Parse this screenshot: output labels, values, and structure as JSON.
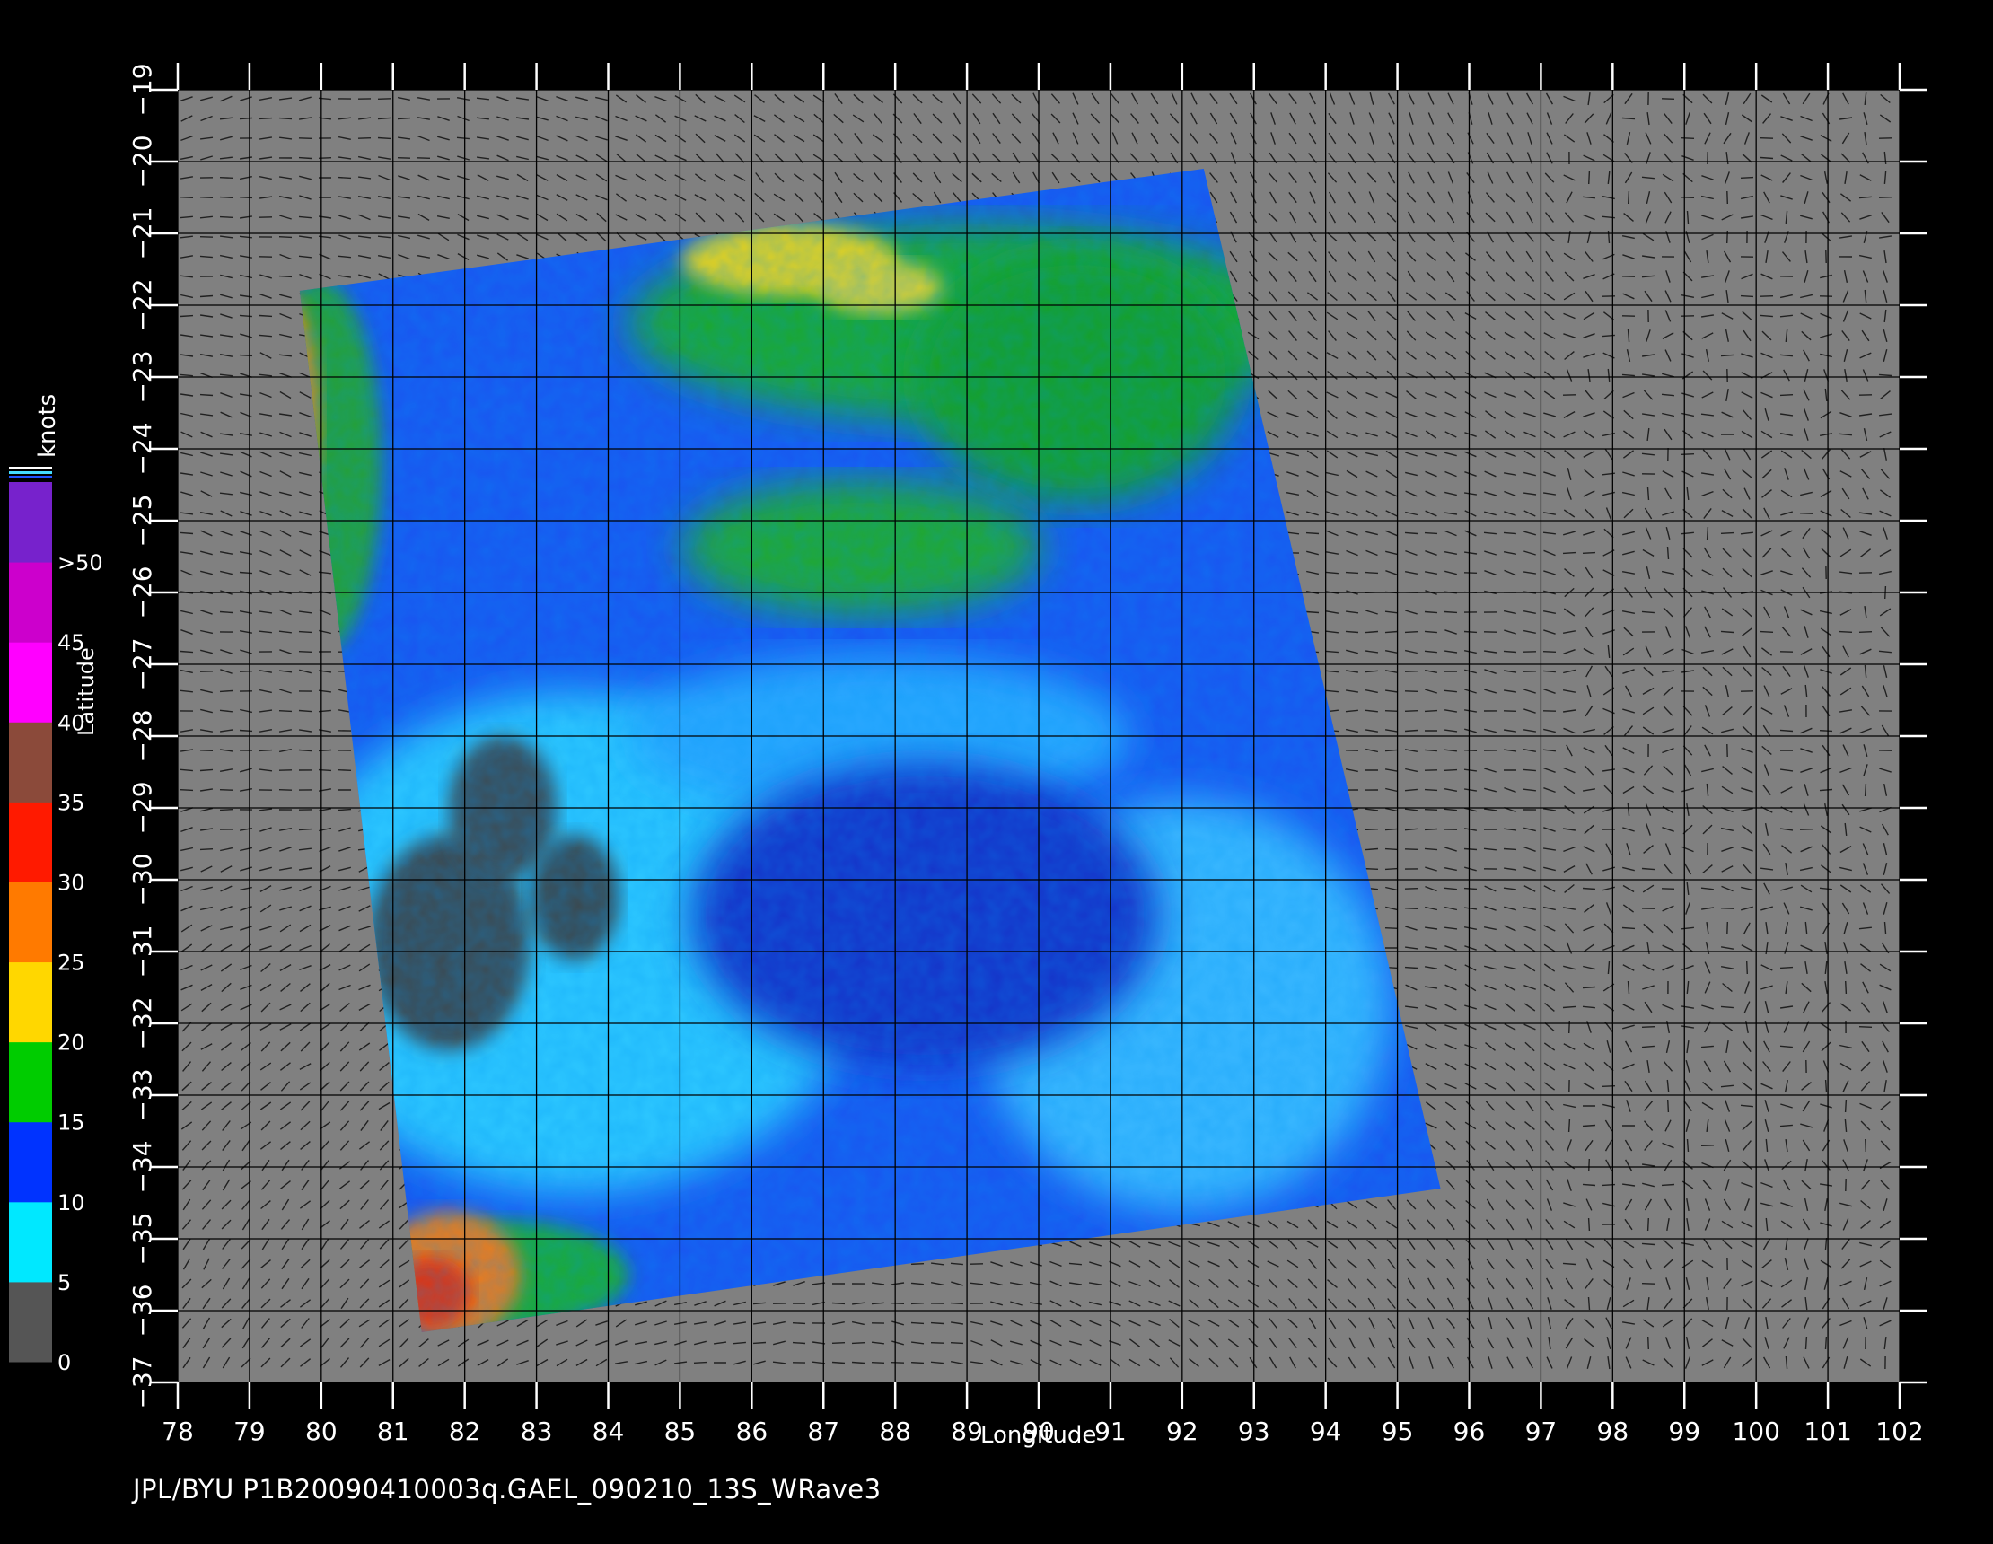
{
  "footer": {
    "text": "JPL/BYU  P1B20090410003q.GAEL_090210_13S_WRave3"
  },
  "chart_data": {
    "type": "heatmap",
    "title": "",
    "xlabel": "Longitude",
    "ylabel": "Latitude",
    "xlim": [
      78,
      102
    ],
    "ylim": [
      -37,
      -19
    ],
    "x_ticks": [
      78,
      79,
      80,
      81,
      82,
      83,
      84,
      85,
      86,
      87,
      88,
      89,
      90,
      91,
      92,
      93,
      94,
      95,
      96,
      97,
      98,
      99,
      100,
      101,
      102
    ],
    "y_ticks": [
      -19,
      -20,
      -21,
      -22,
      -23,
      -24,
      -25,
      -26,
      -27,
      -28,
      -29,
      -30,
      -31,
      -32,
      -33,
      -34,
      -35,
      -36,
      -37
    ],
    "grid": true,
    "swath_corners_lonlat": [
      [
        79.7,
        -21.8
      ],
      [
        92.3,
        -20.1
      ],
      [
        95.6,
        -34.3
      ],
      [
        81.4,
        -36.3
      ]
    ],
    "colorbar": {
      "title": "knots",
      "tick_labels": [
        ">50",
        "45",
        "40",
        "35",
        "30",
        "25",
        "20",
        "15",
        "10",
        "5",
        "0"
      ],
      "segments": [
        {
          "from": 0,
          "to": 5,
          "color": "#555555"
        },
        {
          "from": 5,
          "to": 10,
          "color": "#00e8ff"
        },
        {
          "from": 10,
          "to": 15,
          "color": "#0033ff"
        },
        {
          "from": 15,
          "to": 20,
          "color": "#00cc00"
        },
        {
          "from": 20,
          "to": 25,
          "color": "#ffd700"
        },
        {
          "from": 25,
          "to": 30,
          "color": "#ff7a00"
        },
        {
          "from": 30,
          "to": 35,
          "color": "#ff1a00"
        },
        {
          "from": 35,
          "to": 40,
          "color": "#8b4a3a"
        },
        {
          "from": 40,
          "to": 45,
          "color": "#ff00ff"
        },
        {
          "from": 45,
          "to": 50,
          "color": "#cc00cc"
        },
        {
          "from": 50,
          "to": 55,
          "color": "#7722cc"
        }
      ]
    },
    "regions": [
      {
        "name": "green-north-band",
        "speed_class": "15-20",
        "center": [
          87.5,
          -22.8
        ]
      },
      {
        "name": "yellow-north",
        "speed_class": "20-25",
        "center": [
          86.0,
          -21.6
        ]
      },
      {
        "name": "orange-west-edge",
        "speed_class": "25-35",
        "center": [
          80.2,
          -23.5
        ]
      },
      {
        "name": "red-south-west",
        "speed_class": "30-35",
        "center": [
          81.9,
          -35.8
        ]
      },
      {
        "name": "dark-low-wind",
        "speed_class": "0-5",
        "center": [
          83.0,
          -30.5
        ]
      }
    ]
  },
  "colors": {
    "background": "#000000",
    "land_fill": "#808080",
    "grid": "#000000"
  }
}
